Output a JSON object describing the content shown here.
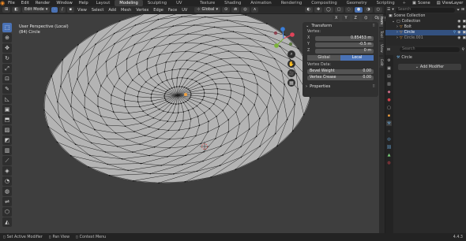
{
  "menu": {
    "items": [
      "File",
      "Edit",
      "Render",
      "Window",
      "Help"
    ],
    "workspaces": [
      "Layout",
      "Modeling",
      "Sculpting",
      "UV Editing",
      "Texture Paint",
      "Shading",
      "Animation",
      "Rendering",
      "Compositing",
      "Geometry Nodes",
      "Scripting"
    ],
    "active_workspace": "Modeling",
    "scene": "Scene",
    "view_layer": "ViewLayer"
  },
  "header": {
    "mode": "Edit Mode",
    "menus": [
      "View",
      "Select",
      "Add",
      "Mesh",
      "Vertex",
      "Edge",
      "Face",
      "UV"
    ],
    "transform_orientation": "Global",
    "options_label": "Options"
  },
  "viewport": {
    "perspective": "User Perspective (Local)",
    "object": "(84) Circle"
  },
  "npanel": {
    "transform_title": "Transform",
    "vertex_label": "Vertex:",
    "x": {
      "label": "X",
      "value": "0.85453 m"
    },
    "y": {
      "label": "Y",
      "value": "-0.5 m"
    },
    "z": {
      "label": "Z",
      "value": "0 m"
    },
    "global_label": "Global",
    "local_label": "Local",
    "vertex_data_label": "Vertex Data:",
    "bevel_weight": {
      "label": "Bevel Weight",
      "value": "0.00"
    },
    "vertex_crease": {
      "label": "Vertex Crease",
      "value": "0.00"
    },
    "properties_title": "Properties"
  },
  "side_tabs": [
    "Item",
    "Tool",
    "View",
    "Edit"
  ],
  "outliner": {
    "root": "Scene Collection",
    "collection": "Collection",
    "items": [
      "Bolt",
      "Circle",
      "Circle.001"
    ],
    "selected": "Circle"
  },
  "properties": {
    "object_name": "Circle",
    "add_modifier": "Add Modifier",
    "search_placeholder": "Search"
  },
  "status": {
    "left": "Set Active Modifier",
    "middle": "Pan View",
    "right": "Context Menu",
    "version": "4.4.3"
  },
  "colors": {
    "accent": "#4a72b5",
    "viewport_bg": "#3e3e3e",
    "mesh_face": "#b4b4b4",
    "wire": "#1e1e1e"
  }
}
